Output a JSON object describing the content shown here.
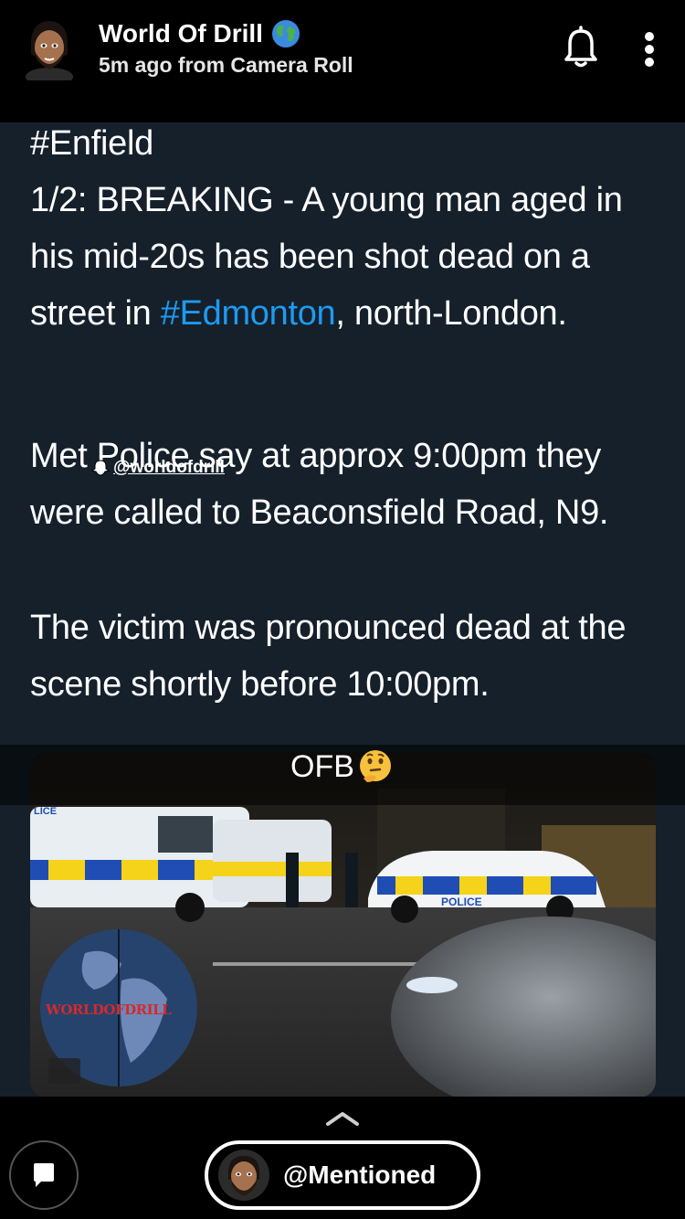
{
  "header": {
    "title": "World Of Drill",
    "subtitle": "5m ago from Camera Roll",
    "title_icon": "globe-icon",
    "notification_icon": "bell-icon",
    "more_icon": "more-vertical-icon"
  },
  "tweet": {
    "hashtag_top": "#Enfield",
    "para1_text": "1/2: BREAKING - A young man aged in his mid-20s has been shot dead on a street in ",
    "para1_tag": "#Edmonton",
    "para1_rest": ", north-London.",
    "para2": "Met Police say at approx 9:00pm they were called to Beaconsfield Road, N9.",
    "para3": "The victim was pronounced dead at the scene shortly before 10:00pm.",
    "watermark": "@worldofdrill",
    "link_color": "#1d9bf0",
    "background_color": "#15202b"
  },
  "media": {
    "caption": "OFB",
    "caption_emoji": "thinking-face-emoji",
    "logo_text": "WORLDOFDRILL",
    "van_text": "POLICE",
    "van_text_left": "LICE"
  },
  "bottom": {
    "mention_label": "@Mentioned",
    "chat_icon": "chat-icon",
    "chevron_icon": "chevron-up-icon"
  }
}
